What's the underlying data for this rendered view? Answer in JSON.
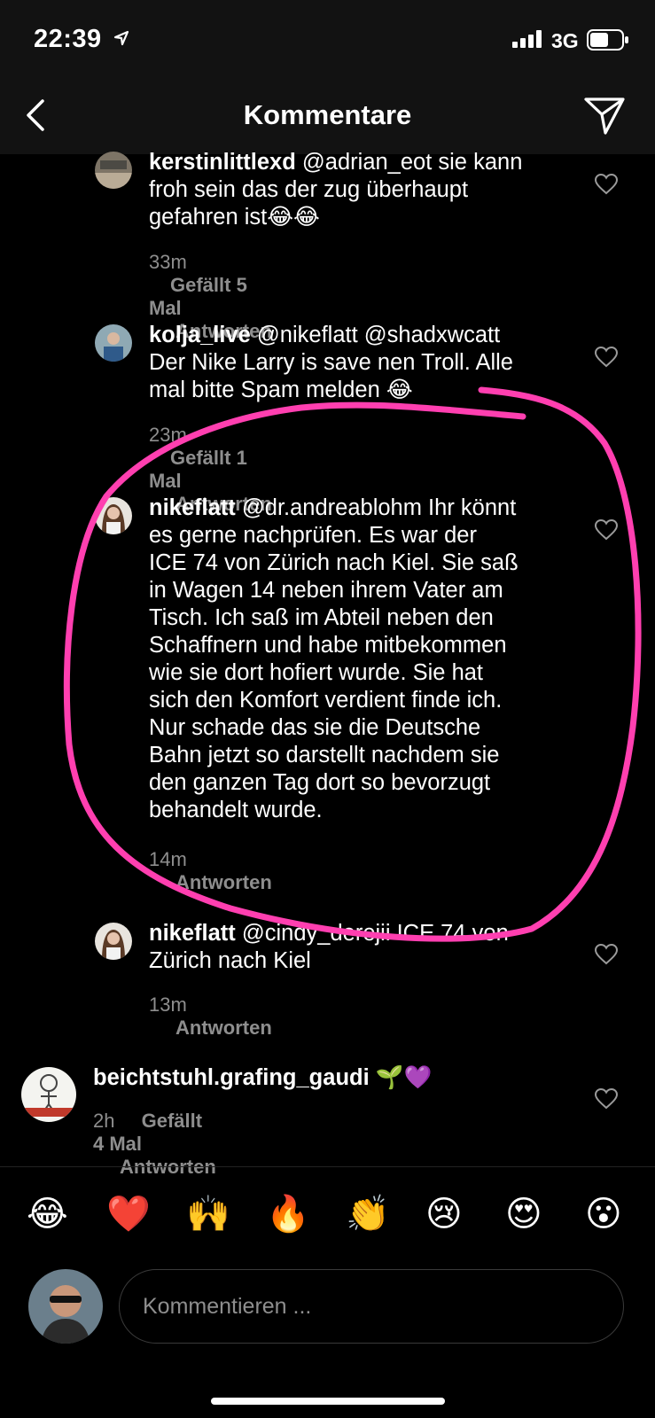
{
  "status_bar": {
    "time": "22:39",
    "network": "3G"
  },
  "header": {
    "title": "Kommentare"
  },
  "comments": [
    {
      "username": "kerstinlittlexd",
      "lines": [
        "@adrian_eot sie kann",
        "froh sein das der zug überhaupt",
        "gefahren ist😂😂"
      ],
      "time": "33m",
      "likes": "Gefällt 5 Mal",
      "reply": "Antworten"
    },
    {
      "username": "kolja_live",
      "lines": [
        "@nikeflatt @shadxwcatt",
        "Der Nike Larry is save nen Troll. Alle",
        "mal bitte Spam melden 😂"
      ],
      "time": "23m",
      "likes": "Gefällt 1 Mal",
      "reply": "Antworten"
    },
    {
      "username": "nikeflatt",
      "lines": [
        "@dr.andreablohm Ihr könnt",
        "es gerne nachprüfen. Es war der",
        "ICE 74 von Zürich nach Kiel. Sie saß",
        "in Wagen 14 neben ihrem Vater am",
        "Tisch. Ich saß im Abteil neben den",
        "Schaffnern und habe mitbekommen",
        "wie sie dort hofiert wurde. Sie hat",
        "sich den Komfort verdient finde ich.",
        "Nur schade das sie die Deutsche",
        "Bahn jetzt so darstellt nachdem sie",
        "den ganzen Tag dort so bevorzugt",
        "behandelt wurde."
      ],
      "time": "14m",
      "reply": "Antworten"
    },
    {
      "username": "nikeflatt",
      "lines": [
        "@cindy_derejii ICE 74 von",
        "Zürich nach Kiel"
      ],
      "time": "13m",
      "reply": "Antworten"
    },
    {
      "username": "beichtstuhl.grafing_gaudi",
      "lines": [
        "🌱💜"
      ],
      "time": "2h",
      "likes": "Gefällt 4 Mal",
      "reply": "Antworten"
    }
  ],
  "emoji_bar": [
    "😂",
    "❤️",
    "🙌",
    "🔥",
    "👏",
    "😢",
    "😍",
    "😮"
  ],
  "composer": {
    "placeholder": "Kommentieren ..."
  },
  "colors": {
    "background": "#000000",
    "bar": "#121212",
    "secondary_text": "#8e8e8e",
    "annotation": "#ff3fb0"
  }
}
